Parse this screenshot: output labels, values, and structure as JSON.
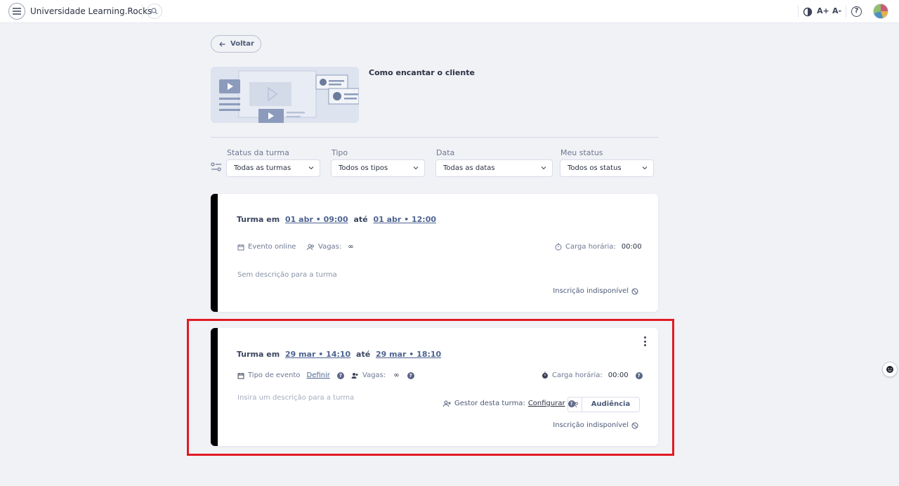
{
  "topbar": {
    "brand": "Universidade Learning.Rocks",
    "font_increase": "A+",
    "font_decrease": "A-",
    "help": "?"
  },
  "back_label": "Voltar",
  "course": {
    "title": "Como encantar o cliente"
  },
  "filters": [
    {
      "label": "Status da turma",
      "value": "Todas as turmas"
    },
    {
      "label": "Tipo",
      "value": "Todos os tipos"
    },
    {
      "label": "Data",
      "value": "Todas as datas"
    },
    {
      "label": "Meu status",
      "value": "Todos os status"
    }
  ],
  "classes": [
    {
      "prefix": "Turma em",
      "start": "01 abr • 09:00",
      "connector": "até",
      "end": "01 abr • 12:00",
      "type_label": "Evento online",
      "vagas_label": "Vagas:",
      "vagas_value": "∞",
      "carga_label": "Carga horária:",
      "carga_value": "00:00",
      "description": "Sem descrição para a turma",
      "status": "Inscrição indisponível"
    },
    {
      "prefix": "Turma em",
      "start": "29 mar • 14:10",
      "connector": "até",
      "end": "29 mar • 18:10",
      "type_label": "Tipo de evento",
      "type_link": "Definir",
      "vagas_label": "Vagas:",
      "vagas_value": "∞",
      "carga_label": "Carga horária:",
      "carga_value": "00:00",
      "description_placeholder": "Insira um descrição para a turma",
      "gestor_label": "Gestor desta turma:",
      "gestor_link": "Configurar",
      "audiencia": "Audiência",
      "status": "Inscrição indisponível"
    }
  ],
  "colors": {
    "accent": "#4e6490",
    "highlight": "#e01b24",
    "card_bar": "#000000"
  }
}
